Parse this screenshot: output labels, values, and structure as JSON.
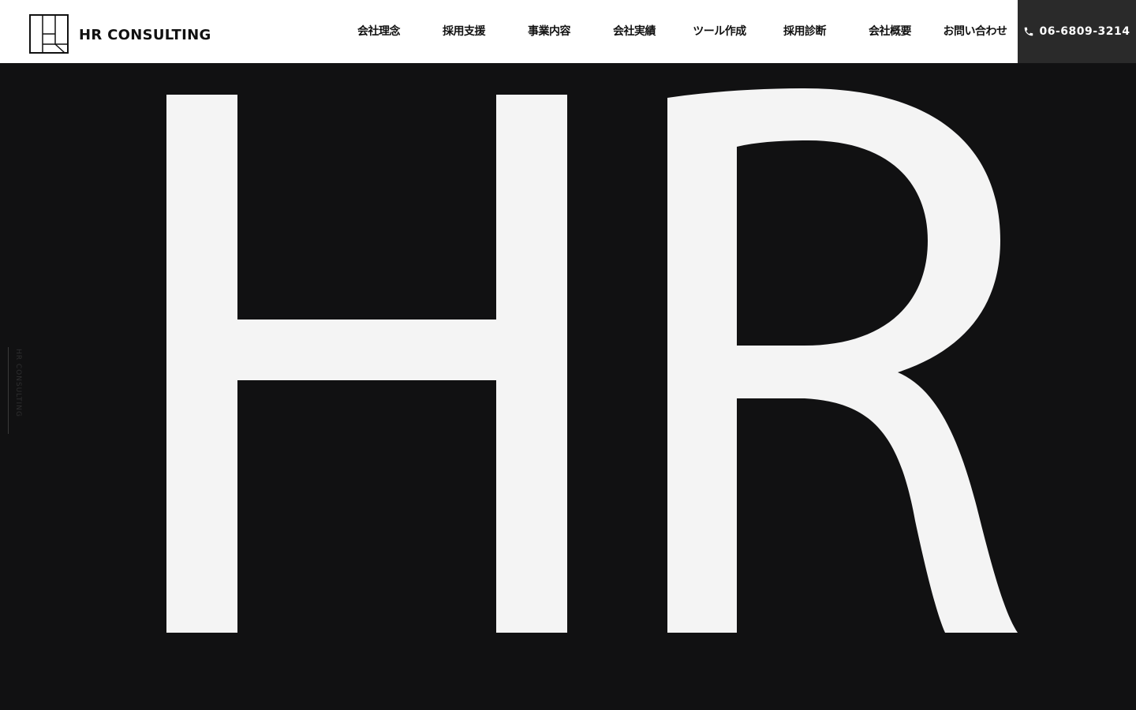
{
  "brand": {
    "name": "HR CONSULTING"
  },
  "nav": {
    "items": [
      {
        "label": "会社理念"
      },
      {
        "label": "採用支援"
      },
      {
        "label": "事業内容"
      },
      {
        "label": "会社実績"
      },
      {
        "label": "ツール作成"
      },
      {
        "label": "採用診断"
      },
      {
        "label": "会社概要"
      },
      {
        "label": "お問い合わせ"
      }
    ]
  },
  "contact": {
    "phone": "06-6809-3214",
    "icon": "phone-icon"
  },
  "hero": {
    "letters": "HR",
    "side_label": "HR CONSULTING"
  },
  "colors": {
    "header_bg": "#ffffff",
    "hero_bg": "#111112",
    "hero_text": "#f4f4f4",
    "phone_bg": "#2a2a2a",
    "nav_text": "#111111"
  }
}
